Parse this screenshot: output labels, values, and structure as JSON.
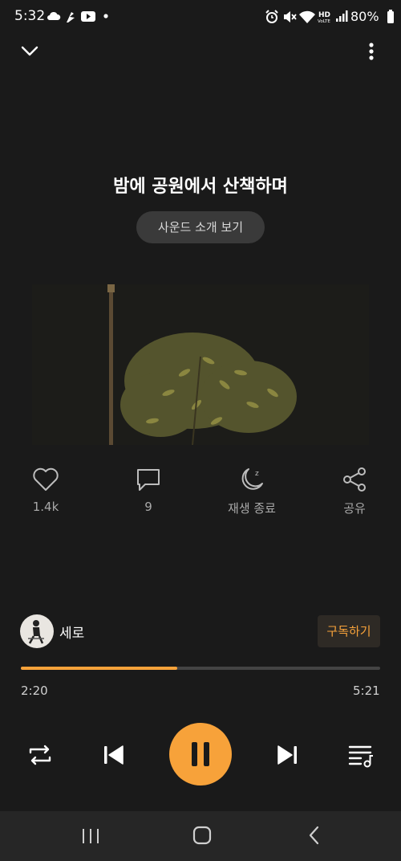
{
  "status_bar": {
    "time": "5:32",
    "battery": "80%",
    "left_icons": [
      "cloud-icon",
      "tuner-icon",
      "youtube-icon",
      "dot-icon"
    ],
    "right_icons": [
      "alarm-icon",
      "mute-icon",
      "wifi-icon",
      "hd-voice-icon",
      "signal-icon",
      "battery-icon"
    ]
  },
  "header": {
    "collapse_icon": "chevron-down-icon",
    "more_icon": "more-vertical-icon"
  },
  "track": {
    "title": "밤에 공원에서 산책하며",
    "intro_button": "사운드 소개 보기"
  },
  "actions": {
    "like": {
      "icon": "heart-icon",
      "label": "1.4k"
    },
    "comment": {
      "icon": "comment-icon",
      "label": "9"
    },
    "sleep_timer": {
      "icon": "moon-icon",
      "label": "재생 종료"
    },
    "share": {
      "icon": "share-icon",
      "label": "공유"
    }
  },
  "artist": {
    "name": "세로",
    "subscribe_label": "구독하기"
  },
  "progress": {
    "elapsed": "2:20",
    "total": "5:21",
    "fraction": 0.436
  },
  "controls": {
    "repeat_icon": "repeat-icon",
    "prev_icon": "skip-previous-icon",
    "play_state_icon": "pause-icon",
    "next_icon": "skip-next-icon",
    "playlist_icon": "playlist-icon"
  },
  "colors": {
    "accent": "#f7a23a",
    "background": "#1a1a1a"
  }
}
